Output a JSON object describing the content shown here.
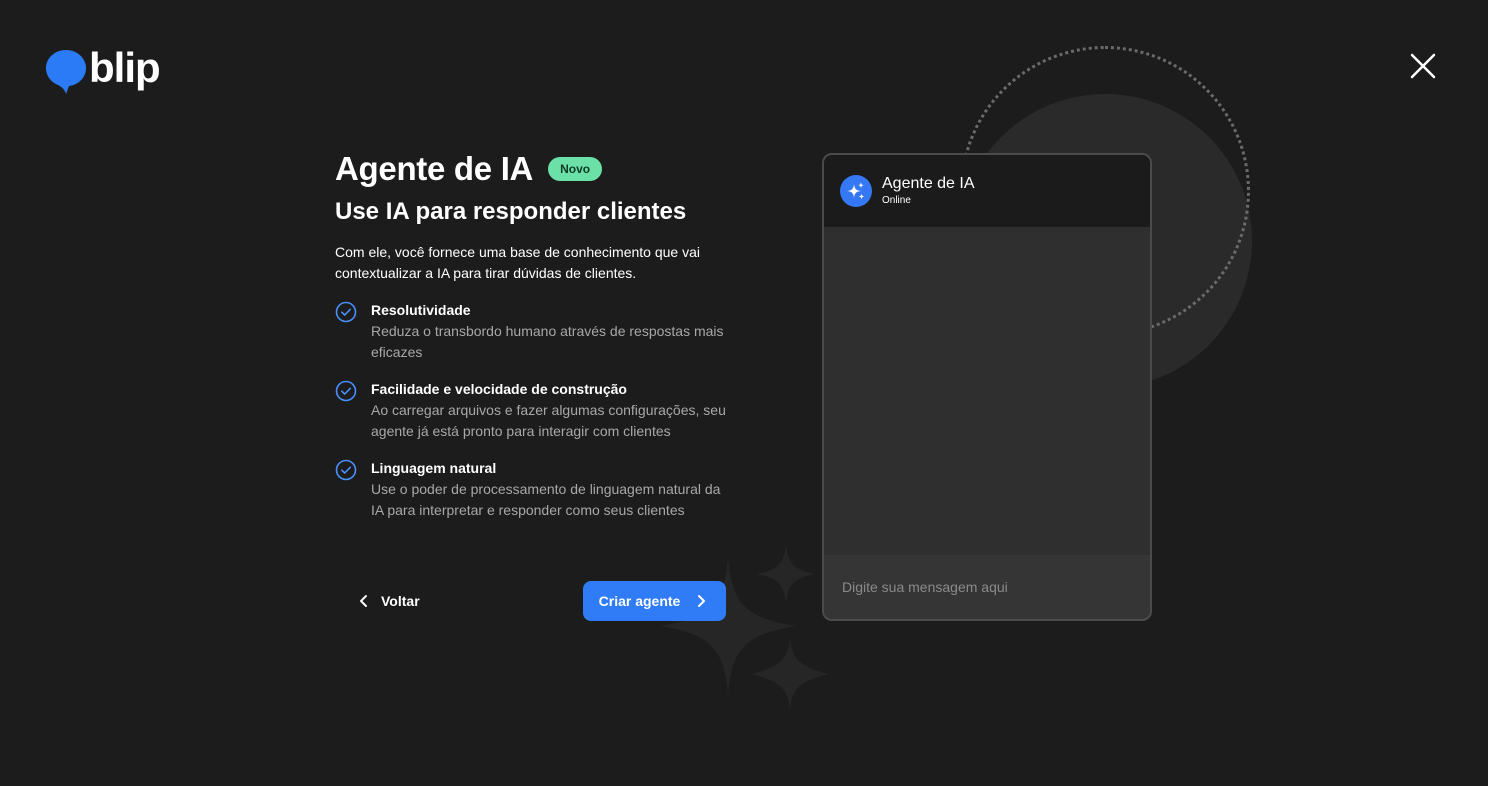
{
  "logo": {
    "text": "blip",
    "brand_color": "#2a7bf5"
  },
  "close": {
    "icon": "close-icon"
  },
  "hero": {
    "title": "Agente de IA",
    "badge": "Novo",
    "subtitle": "Use IA para responder clientes",
    "description": "Com ele, você fornece uma base de conhecimento que vai contextualizar a IA para tirar dúvidas de clientes."
  },
  "features": [
    {
      "title": "Resolutividade",
      "description": "Reduza o transbordo humano através de respostas mais eficazes",
      "icon": "check-circle-icon"
    },
    {
      "title": "Facilidade e velocidade de construção",
      "description": "Ao carregar arquivos e fazer algumas configurações, seu agente já está pronto para interagir com clientes",
      "icon": "check-circle-icon"
    },
    {
      "title": "Linguagem natural",
      "description": "Use o poder de processamento de linguagem natural da IA para interpretar e responder como seus clientes",
      "icon": "check-circle-icon"
    }
  ],
  "actions": {
    "back_label": "Voltar",
    "create_label": "Criar agente",
    "accent": "#2f7cf6"
  },
  "preview": {
    "agent_name": "Agente de IA",
    "agent_status": "Online",
    "input_placeholder": "Digite sua mensagem aqui",
    "avatar_icon": "sparkles-icon"
  }
}
